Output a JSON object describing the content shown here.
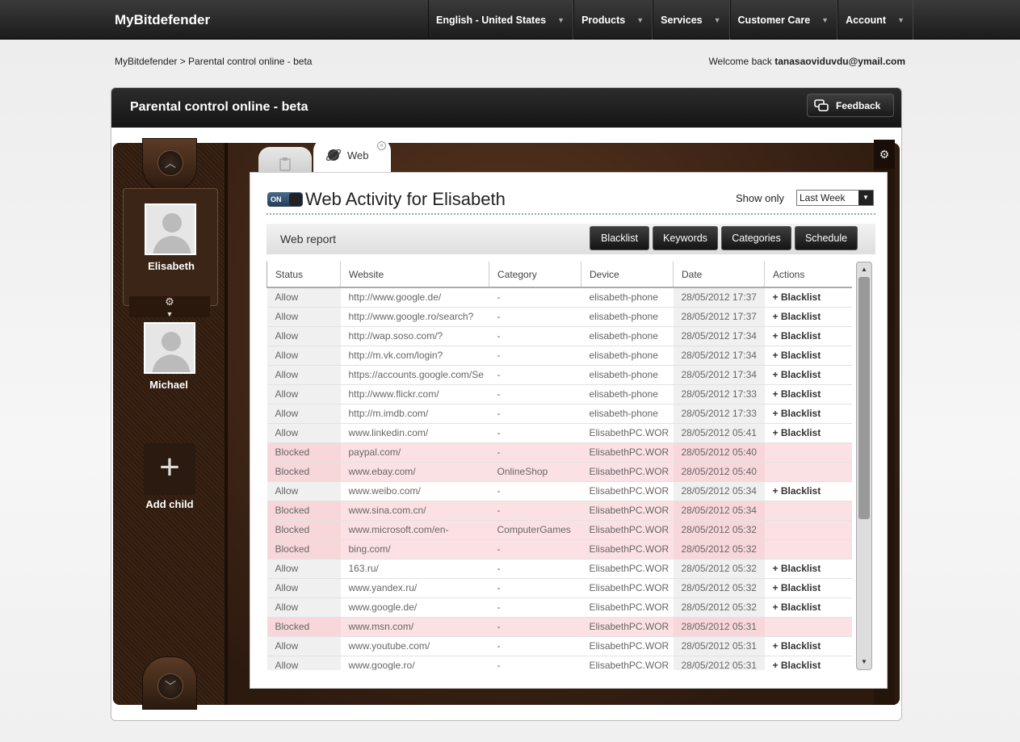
{
  "header": {
    "brand": "MyBitdefender",
    "nav": [
      {
        "label": "English - United States"
      },
      {
        "label": "Products"
      },
      {
        "label": "Services"
      },
      {
        "label": "Customer Care"
      },
      {
        "label": "Account"
      }
    ]
  },
  "breadcrumb": "MyBitdefender > Parental control online - beta",
  "welcome": {
    "prefix": "Welcome back ",
    "email": "tanasaoviduvdu@ymail.com"
  },
  "window": {
    "title": "Parental control online - beta",
    "feedback": "Feedback"
  },
  "sidebar": {
    "children": [
      {
        "name": "Elisabeth"
      },
      {
        "name": "Michael"
      }
    ],
    "add_child": "Add child"
  },
  "tabs": {
    "web": "Web"
  },
  "panel": {
    "toggle": "ON",
    "title": "Web Activity for Elisabeth",
    "show_only": "Show only",
    "period": "Last Week",
    "report_label": "Web report",
    "buttons": [
      "Blacklist",
      "Keywords",
      "Categories",
      "Schedule"
    ]
  },
  "table": {
    "headers": [
      "Status",
      "Website",
      "Category",
      "Device",
      "Date",
      "Actions"
    ],
    "rows": [
      [
        "Allow",
        "http://www.google.de/",
        "-",
        "elisabeth-phone",
        "28/05/2012 17:37",
        "+ Blacklist"
      ],
      [
        "Allow",
        "http://www.google.ro/search?",
        "-",
        "elisabeth-phone",
        "28/05/2012 17:37",
        "+ Blacklist"
      ],
      [
        "Allow",
        "http://wap.soso.com/?",
        "-",
        "elisabeth-phone",
        "28/05/2012 17:34",
        "+ Blacklist"
      ],
      [
        "Allow",
        "http://m.vk.com/login?",
        "-",
        "elisabeth-phone",
        "28/05/2012 17:34",
        "+ Blacklist"
      ],
      [
        "Allow",
        "https://accounts.google.com/Se",
        "-",
        "elisabeth-phone",
        "28/05/2012 17:34",
        "+ Blacklist"
      ],
      [
        "Allow",
        "http://www.flickr.com/",
        "-",
        "elisabeth-phone",
        "28/05/2012 17:33",
        "+ Blacklist"
      ],
      [
        "Allow",
        "http://m.imdb.com/",
        "-",
        "elisabeth-phone",
        "28/05/2012 17:33",
        "+ Blacklist"
      ],
      [
        "Allow",
        "www.linkedin.com/",
        "-",
        "ElisabethPC.WOR",
        "28/05/2012 05:41",
        "+ Blacklist"
      ],
      [
        "Blocked",
        "paypal.com/",
        "-",
        "ElisabethPC.WOR",
        "28/05/2012 05:40",
        ""
      ],
      [
        "Blocked",
        "www.ebay.com/",
        "OnlineShop",
        "ElisabethPC.WOR",
        "28/05/2012 05:40",
        ""
      ],
      [
        "Allow",
        "www.weibo.com/",
        "-",
        "ElisabethPC.WOR",
        "28/05/2012 05:34",
        "+ Blacklist"
      ],
      [
        "Blocked",
        "www.sina.com.cn/",
        "-",
        "ElisabethPC.WOR",
        "28/05/2012 05:34",
        ""
      ],
      [
        "Blocked",
        "www.microsoft.com/en-",
        "ComputerGames",
        "ElisabethPC.WOR",
        "28/05/2012 05:32",
        ""
      ],
      [
        "Blocked",
        "bing.com/",
        "-",
        "ElisabethPC.WOR",
        "28/05/2012 05:32",
        ""
      ],
      [
        "Allow",
        "163.ru/",
        "-",
        "ElisabethPC.WOR",
        "28/05/2012 05:32",
        "+ Blacklist"
      ],
      [
        "Allow",
        "www.yandex.ru/",
        "-",
        "ElisabethPC.WOR",
        "28/05/2012 05:32",
        "+ Blacklist"
      ],
      [
        "Allow",
        "www.google.de/",
        "-",
        "ElisabethPC.WOR",
        "28/05/2012 05:32",
        "+ Blacklist"
      ],
      [
        "Blocked",
        "www.msn.com/",
        "-",
        "ElisabethPC.WOR",
        "28/05/2012 05:31",
        ""
      ],
      [
        "Allow",
        "www.youtube.com/",
        "-",
        "ElisabethPC.WOR",
        "28/05/2012 05:31",
        "+ Blacklist"
      ],
      [
        "Allow",
        "www.google.ro/",
        "-",
        "ElisabethPC.WOR",
        "28/05/2012 05:31",
        "+ Blacklist"
      ]
    ]
  },
  "colors": {
    "blocked_row": "#fce1e4",
    "header_bg": "#1c1c1c",
    "frame_brown": "#3a2314"
  }
}
